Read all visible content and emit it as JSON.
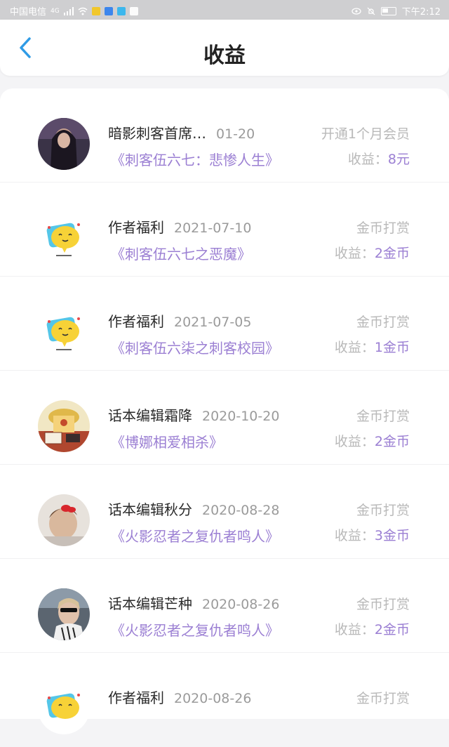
{
  "status_bar": {
    "carrier": "中国电信",
    "signal": "4G",
    "time": "下午2:12"
  },
  "header": {
    "title": "收益",
    "back_icon": "chevron-left-icon"
  },
  "earnings": [
    {
      "name": "暗影刺客首席…",
      "date": "01-20",
      "type": "开通1个月会员",
      "book": "《刺客伍六七：悲惨人生》",
      "earn_label": "收益：",
      "amount": "8元",
      "avatar": "avatar-dark-portrait"
    },
    {
      "name": "作者福利",
      "date": "2021-07-10",
      "type": "金币打赏",
      "book": "《刺客伍六七之恶魔》",
      "earn_label": "收益：",
      "amount": "2金币",
      "avatar": "avatar-yellow-mascot"
    },
    {
      "name": "作者福利",
      "date": "2021-07-05",
      "type": "金币打赏",
      "book": "《刺客伍六柒之刺客校园》",
      "earn_label": "收益：",
      "amount": "1金币",
      "avatar": "avatar-yellow-mascot"
    },
    {
      "name": "话本编辑霜降",
      "date": "2020-10-20",
      "type": "金币打赏",
      "book": "《博娜相爱相杀》",
      "earn_label": "收益：",
      "amount": "2金币",
      "avatar": "avatar-illustration"
    },
    {
      "name": "话本编辑秋分",
      "date": "2020-08-28",
      "type": "金币打赏",
      "book": "《火影忍者之复仇者鸣人》",
      "earn_label": "收益：",
      "amount": "3金币",
      "avatar": "avatar-girl-bow"
    },
    {
      "name": "话本编辑芒种",
      "date": "2020-08-26",
      "type": "金币打赏",
      "book": "《火影忍者之复仇者鸣人》",
      "earn_label": "收益：",
      "amount": "2金币",
      "avatar": "avatar-sunglasses"
    },
    {
      "name": "作者福利",
      "date": "2020-08-26",
      "type": "金币打赏",
      "book": "",
      "earn_label": "",
      "amount": "",
      "avatar": "avatar-yellow-mascot"
    }
  ]
}
